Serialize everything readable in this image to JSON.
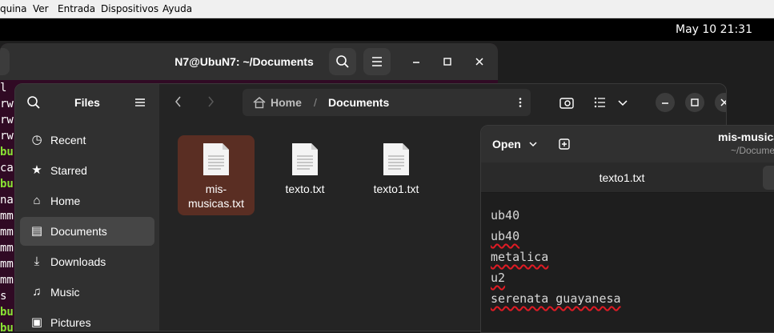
{
  "vm_menu": [
    "quina",
    "Ver",
    "Entrada",
    "Dispositivos",
    "Ayuda"
  ],
  "topbar": {
    "clock": "May 10  21:31"
  },
  "terminal": {
    "title": "N7@UbuN7: ~/Documents",
    "lines": [
      {
        "t": "l",
        "g": false
      },
      {
        "t": "rw",
        "g": false
      },
      {
        "t": "rw",
        "g": false
      },
      {
        "t": "rw",
        "g": false
      },
      {
        "t": "bu",
        "g": true
      },
      {
        "t": "ca",
        "g": false
      },
      {
        "t": "bu",
        "g": true
      },
      {
        "t": "na",
        "g": false
      },
      {
        "t": "mm",
        "g": false
      },
      {
        "t": "mm",
        "g": false
      },
      {
        "t": "mm",
        "g": false
      },
      {
        "t": "mm",
        "g": false
      },
      {
        "t": "mm",
        "g": false
      },
      {
        "t": "s",
        "g": false
      },
      {
        "t": "bu",
        "g": true
      },
      {
        "t": "bu",
        "g": true
      }
    ]
  },
  "files": {
    "sidebar_title": "Files",
    "sidebar": [
      {
        "label": "Recent",
        "icon": "clock-icon",
        "glyph": "◷"
      },
      {
        "label": "Starred",
        "icon": "star-icon",
        "glyph": "★"
      },
      {
        "label": "Home",
        "icon": "home-icon",
        "glyph": "⌂"
      },
      {
        "label": "Documents",
        "icon": "document-icon",
        "glyph": "▤",
        "active": true
      },
      {
        "label": "Downloads",
        "icon": "download-icon",
        "glyph": "⤓"
      },
      {
        "label": "Music",
        "icon": "music-icon",
        "glyph": "♫"
      },
      {
        "label": "Pictures",
        "icon": "pictures-icon",
        "glyph": "▣"
      }
    ],
    "path": {
      "home": "Home",
      "separator": "/",
      "current": "Documents"
    },
    "items": [
      {
        "name": "mis-musicas.txt",
        "line1": "mis-",
        "line2": "musicas.txt",
        "selected": true
      },
      {
        "name": "texto.txt",
        "line1": "texto.txt",
        "line2": "",
        "selected": false
      },
      {
        "name": "texto1.txt",
        "line1": "texto1.txt",
        "line2": "",
        "selected": false
      }
    ]
  },
  "editor": {
    "open_label": "Open",
    "title": "mis-musicas",
    "subtitle": "~/Docume",
    "tab": "texto1.txt",
    "lines": [
      "ub40",
      "ub40",
      "metalica",
      "u2",
      "serenata guayanesa"
    ]
  },
  "colors": {
    "selection": "#5a2e23",
    "terminal_bg": "#300a24",
    "accent_green": "#8ae234",
    "spell_error": "#e01b24"
  }
}
